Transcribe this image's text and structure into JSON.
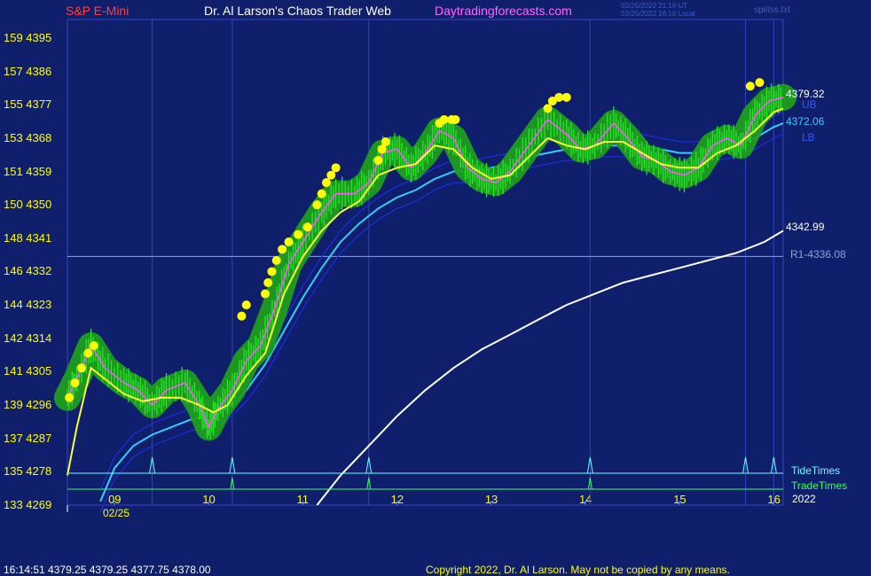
{
  "header": {
    "left": "S&P E-Mini",
    "center": "Dr. Al Larson's Chaos Trader Web",
    "site": "Daytradingforecasts.com",
    "stamp_utc": "02/25/2022 21:16 UT",
    "stamp_local": "02/25/2022 16:16 Local",
    "file": "spiitss.txt"
  },
  "colors": {
    "background": "#0f1f6b",
    "price": "#22ee22",
    "glow": "#1f9e1f",
    "mid": "#ff55ff",
    "fast_ma": "#ffff33",
    "medium_ma": "#33ccff",
    "slow_ma": "#ffffff",
    "bands": "#1a2ee0",
    "dots": "#ffff00",
    "r1": "#8ea2d8",
    "tide": "#66ffff",
    "trade": "#33ff66"
  },
  "chart_data": {
    "type": "line",
    "title": "S&P E-Mini",
    "x_labels": [
      "09",
      "10",
      "11",
      "12",
      "13",
      "14",
      "15",
      "16"
    ],
    "date_label": "02/25",
    "year_label": "2022",
    "x_range": [
      8.5,
      16.1
    ],
    "y_range": [
      4269,
      4400
    ],
    "y_ticks": [
      {
        "left": "159",
        "right": "4395",
        "value": 4395
      },
      {
        "left": "157",
        "right": "4386",
        "value": 4386
      },
      {
        "left": "155",
        "right": "4377",
        "value": 4377
      },
      {
        "left": "153",
        "right": "4368",
        "value": 4368
      },
      {
        "left": "151",
        "right": "4359",
        "value": 4359
      },
      {
        "left": "150",
        "right": "4350",
        "value": 4350
      },
      {
        "left": "148",
        "right": "4341",
        "value": 4341
      },
      {
        "left": "146",
        "right": "4332",
        "value": 4332
      },
      {
        "left": "144",
        "right": "4323",
        "value": 4323
      },
      {
        "left": "142",
        "right": "4314",
        "value": 4314
      },
      {
        "left": "141",
        "right": "4305",
        "value": 4305
      },
      {
        "left": "139",
        "right": "4296",
        "value": 4296
      },
      {
        "left": "137",
        "right": "4287",
        "value": 4287
      },
      {
        "left": "135",
        "right": "4278",
        "value": 4278
      },
      {
        "left": "133",
        "right": "4269",
        "value": 4269
      }
    ],
    "price": [
      [
        8.5,
        4298
      ],
      [
        8.6,
        4303
      ],
      [
        8.75,
        4312
      ],
      [
        8.9,
        4306
      ],
      [
        9.1,
        4302
      ],
      [
        9.25,
        4300
      ],
      [
        9.4,
        4296
      ],
      [
        9.55,
        4300
      ],
      [
        9.75,
        4302
      ],
      [
        9.9,
        4296
      ],
      [
        10.0,
        4290
      ],
      [
        10.1,
        4295
      ],
      [
        10.25,
        4300
      ],
      [
        10.4,
        4308
      ],
      [
        10.55,
        4312
      ],
      [
        10.7,
        4322
      ],
      [
        10.85,
        4334
      ],
      [
        11.0,
        4340
      ],
      [
        11.2,
        4348
      ],
      [
        11.35,
        4353
      ],
      [
        11.55,
        4353
      ],
      [
        11.7,
        4356
      ],
      [
        11.85,
        4364
      ],
      [
        12.0,
        4365
      ],
      [
        12.15,
        4360
      ],
      [
        12.3,
        4364
      ],
      [
        12.45,
        4370
      ],
      [
        12.6,
        4368
      ],
      [
        12.75,
        4360
      ],
      [
        12.9,
        4357
      ],
      [
        13.05,
        4356
      ],
      [
        13.2,
        4359
      ],
      [
        13.4,
        4366
      ],
      [
        13.6,
        4373
      ],
      [
        13.8,
        4369
      ],
      [
        13.95,
        4365
      ],
      [
        14.1,
        4366
      ],
      [
        14.3,
        4372
      ],
      [
        14.45,
        4368
      ],
      [
        14.6,
        4363
      ],
      [
        14.75,
        4362
      ],
      [
        14.9,
        4359
      ],
      [
        15.05,
        4358
      ],
      [
        15.2,
        4360
      ],
      [
        15.35,
        4366
      ],
      [
        15.5,
        4368
      ],
      [
        15.65,
        4366
      ],
      [
        15.8,
        4374
      ],
      [
        15.95,
        4378
      ],
      [
        16.1,
        4379
      ]
    ],
    "fast_ma": [
      [
        8.5,
        4277
      ],
      [
        8.6,
        4290
      ],
      [
        8.75,
        4306
      ],
      [
        8.9,
        4303
      ],
      [
        9.1,
        4299
      ],
      [
        9.3,
        4297
      ],
      [
        9.5,
        4298
      ],
      [
        9.7,
        4298
      ],
      [
        9.9,
        4296
      ],
      [
        10.05,
        4294
      ],
      [
        10.2,
        4296
      ],
      [
        10.4,
        4304
      ],
      [
        10.6,
        4310
      ],
      [
        10.8,
        4326
      ],
      [
        11.0,
        4336
      ],
      [
        11.2,
        4343
      ],
      [
        11.4,
        4348
      ],
      [
        11.6,
        4351
      ],
      [
        11.8,
        4358
      ],
      [
        12.0,
        4360
      ],
      [
        12.2,
        4361
      ],
      [
        12.4,
        4366
      ],
      [
        12.6,
        4365
      ],
      [
        12.8,
        4360
      ],
      [
        13.0,
        4357
      ],
      [
        13.2,
        4358
      ],
      [
        13.4,
        4363
      ],
      [
        13.6,
        4368
      ],
      [
        13.8,
        4366
      ],
      [
        14.0,
        4365
      ],
      [
        14.2,
        4367
      ],
      [
        14.4,
        4367
      ],
      [
        14.6,
        4364
      ],
      [
        14.8,
        4361
      ],
      [
        15.0,
        4360
      ],
      [
        15.2,
        4360
      ],
      [
        15.4,
        4364
      ],
      [
        15.6,
        4366
      ],
      [
        15.8,
        4370
      ],
      [
        16.0,
        4375
      ],
      [
        16.1,
        4376
      ]
    ],
    "medium_ma": [
      [
        8.85,
        4270
      ],
      [
        9.0,
        4279
      ],
      [
        9.2,
        4285
      ],
      [
        9.4,
        4288
      ],
      [
        9.6,
        4290
      ],
      [
        9.8,
        4292
      ],
      [
        10.0,
        4293
      ],
      [
        10.2,
        4295
      ],
      [
        10.4,
        4300
      ],
      [
        10.6,
        4307
      ],
      [
        10.8,
        4316
      ],
      [
        11.0,
        4325
      ],
      [
        11.2,
        4333
      ],
      [
        11.4,
        4340
      ],
      [
        11.6,
        4345
      ],
      [
        11.8,
        4349
      ],
      [
        12.0,
        4352
      ],
      [
        12.2,
        4354
      ],
      [
        12.4,
        4357
      ],
      [
        12.6,
        4359
      ],
      [
        12.8,
        4359
      ],
      [
        13.0,
        4360
      ],
      [
        13.2,
        4361
      ],
      [
        13.4,
        4363
      ],
      [
        13.6,
        4364
      ],
      [
        13.8,
        4365
      ],
      [
        14.0,
        4365
      ],
      [
        14.2,
        4366
      ],
      [
        14.4,
        4366
      ],
      [
        14.6,
        4366
      ],
      [
        14.8,
        4365
      ],
      [
        15.0,
        4364
      ],
      [
        15.2,
        4364
      ],
      [
        15.4,
        4365
      ],
      [
        15.6,
        4366
      ],
      [
        15.8,
        4368
      ],
      [
        16.0,
        4371
      ],
      [
        16.1,
        4372
      ]
    ],
    "slow_ma": [
      [
        11.15,
        4269
      ],
      [
        11.4,
        4277
      ],
      [
        11.7,
        4285
      ],
      [
        12.0,
        4293
      ],
      [
        12.3,
        4300
      ],
      [
        12.6,
        4306
      ],
      [
        12.9,
        4311
      ],
      [
        13.2,
        4315
      ],
      [
        13.5,
        4319
      ],
      [
        13.8,
        4323
      ],
      [
        14.1,
        4326
      ],
      [
        14.4,
        4329
      ],
      [
        14.7,
        4331
      ],
      [
        15.0,
        4333
      ],
      [
        15.3,
        4335
      ],
      [
        15.6,
        4337
      ],
      [
        15.9,
        4340
      ],
      [
        16.1,
        4343
      ]
    ],
    "dots": [
      [
        8.52,
        4298
      ],
      [
        8.58,
        4302
      ],
      [
        8.65,
        4306
      ],
      [
        8.72,
        4310
      ],
      [
        8.78,
        4312
      ],
      [
        10.35,
        4320
      ],
      [
        10.4,
        4323
      ],
      [
        10.6,
        4326
      ],
      [
        10.63,
        4329
      ],
      [
        10.67,
        4332
      ],
      [
        10.72,
        4335
      ],
      [
        10.78,
        4338
      ],
      [
        10.85,
        4340
      ],
      [
        10.95,
        4342
      ],
      [
        11.05,
        4344
      ],
      [
        11.15,
        4350
      ],
      [
        11.2,
        4353
      ],
      [
        11.25,
        4356
      ],
      [
        11.3,
        4358
      ],
      [
        11.35,
        4360
      ],
      [
        11.8,
        4362
      ],
      [
        11.84,
        4365
      ],
      [
        11.88,
        4367
      ],
      [
        12.45,
        4372
      ],
      [
        12.5,
        4373
      ],
      [
        12.58,
        4373
      ],
      [
        12.62,
        4373
      ],
      [
        13.6,
        4376
      ],
      [
        13.65,
        4378
      ],
      [
        13.72,
        4379
      ],
      [
        13.8,
        4379
      ],
      [
        15.75,
        4382
      ],
      [
        15.85,
        4383
      ]
    ],
    "r1": {
      "label": "R1-4336.08",
      "value": 4336.08
    },
    "tide_times": [
      9.4,
      10.25,
      11.7,
      14.05,
      15.7,
      16.0
    ],
    "trade_times": [
      10.25,
      11.7,
      14.05
    ],
    "cycle_lines": [
      9.4,
      10.25,
      11.7,
      14.05,
      15.7,
      16.0
    ],
    "last_values": {
      "price": "4379.32",
      "medium": "4372.06",
      "slow": "4342.99",
      "upper_band": "UB",
      "lower_band": "LB"
    },
    "indicator_labels": {
      "tide": "TideTimes",
      "trade": "TradeTimes"
    },
    "footer_quote": "16:14:51  4379.25 4379.25 4377.75 4378.00",
    "copyright": "Copyright 2022, Dr. Al Larson. May not be copied by any means."
  }
}
